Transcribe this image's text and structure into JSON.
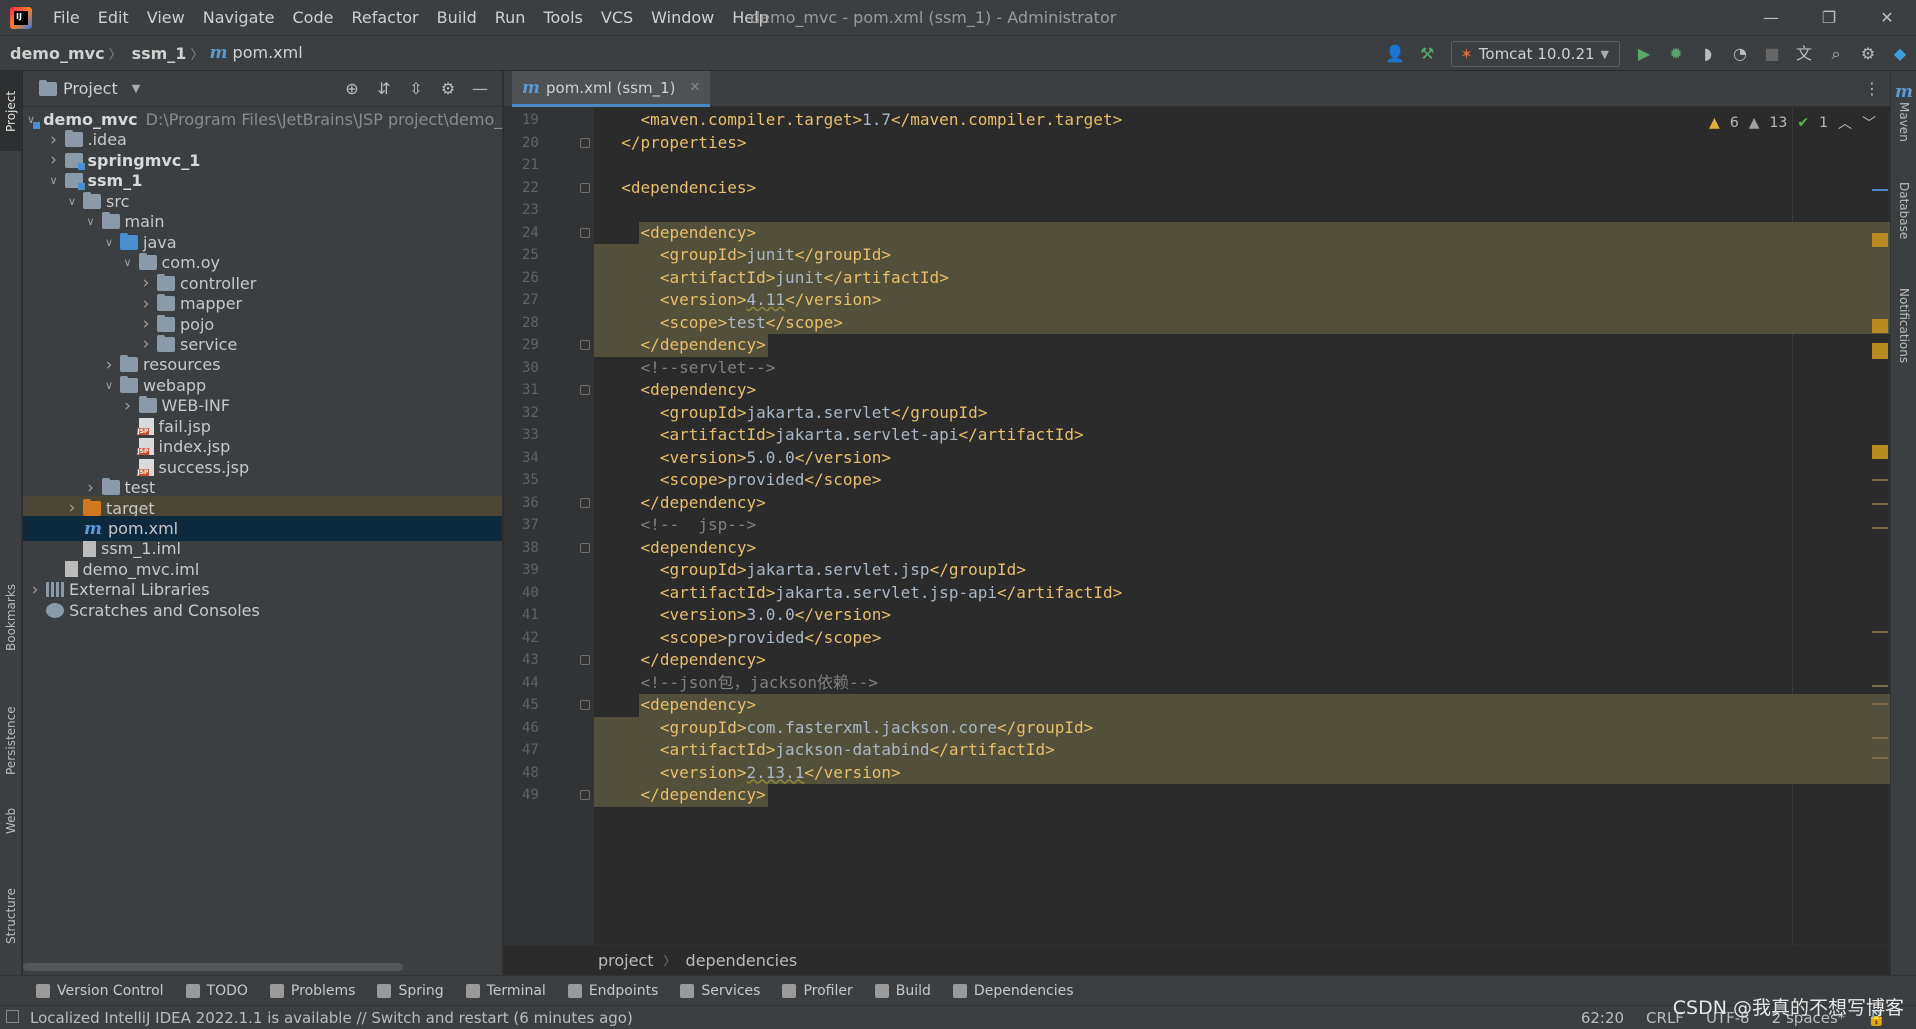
{
  "menubar": {
    "items": [
      "File",
      "Edit",
      "View",
      "Navigate",
      "Code",
      "Refactor",
      "Build",
      "Run",
      "Tools",
      "VCS",
      "Window",
      "Help"
    ],
    "window_title": "demo_mvc - pom.xml (ssm_1) - Administrator"
  },
  "navbar": {
    "crumbs": [
      "demo_mvc",
      "ssm_1"
    ],
    "file": "pom.xml",
    "run_config": "Tomcat 10.0.21"
  },
  "left_strip": {
    "tabs": [
      "Project",
      "Bookmarks",
      "Persistence",
      "Web",
      "Structure"
    ]
  },
  "project_panel": {
    "title": "Project",
    "tree": [
      {
        "label": "demo_mvc",
        "path": "D:\\Program Files\\JetBrains\\JSP project\\demo_",
        "depth": 0,
        "arrow": "down",
        "icon": "module",
        "bold": true
      },
      {
        "label": ".idea",
        "depth": 1,
        "arrow": "right",
        "icon": "folder"
      },
      {
        "label": "springmvc_1",
        "depth": 1,
        "arrow": "right",
        "icon": "module",
        "bold": true
      },
      {
        "label": "ssm_1",
        "depth": 1,
        "arrow": "down",
        "icon": "module",
        "bold": true
      },
      {
        "label": "src",
        "depth": 2,
        "arrow": "down",
        "icon": "folder"
      },
      {
        "label": "main",
        "depth": 3,
        "arrow": "down",
        "icon": "folder"
      },
      {
        "label": "java",
        "depth": 4,
        "arrow": "down",
        "icon": "folder-blue"
      },
      {
        "label": "com.oy",
        "depth": 5,
        "arrow": "down",
        "icon": "folder"
      },
      {
        "label": "controller",
        "depth": 6,
        "arrow": "right",
        "icon": "folder"
      },
      {
        "label": "mapper",
        "depth": 6,
        "arrow": "right",
        "icon": "folder"
      },
      {
        "label": "pojo",
        "depth": 6,
        "arrow": "right",
        "icon": "folder"
      },
      {
        "label": "service",
        "depth": 6,
        "arrow": "right",
        "icon": "folder"
      },
      {
        "label": "resources",
        "depth": 4,
        "arrow": "right",
        "icon": "folder-res"
      },
      {
        "label": "webapp",
        "depth": 4,
        "arrow": "down",
        "icon": "folder"
      },
      {
        "label": "WEB-INF",
        "depth": 5,
        "arrow": "right",
        "icon": "folder"
      },
      {
        "label": "fail.jsp",
        "depth": 5,
        "arrow": "",
        "icon": "jsp"
      },
      {
        "label": "index.jsp",
        "depth": 5,
        "arrow": "",
        "icon": "jsp"
      },
      {
        "label": "success.jsp",
        "depth": 5,
        "arrow": "",
        "icon": "jsp"
      },
      {
        "label": "test",
        "depth": 3,
        "arrow": "right",
        "icon": "folder"
      },
      {
        "label": "target",
        "depth": 2,
        "arrow": "right",
        "icon": "folder-orange",
        "state": "excluded"
      },
      {
        "label": "pom.xml",
        "depth": 2,
        "arrow": "",
        "icon": "maven",
        "state": "selected"
      },
      {
        "label": "ssm_1.iml",
        "depth": 2,
        "arrow": "",
        "icon": "iml"
      },
      {
        "label": "demo_mvc.iml",
        "depth": 1,
        "arrow": "",
        "icon": "iml"
      },
      {
        "label": "External Libraries",
        "depth": 0,
        "arrow": "right",
        "icon": "lib"
      },
      {
        "label": "Scratches and Consoles",
        "depth": 0,
        "arrow": "",
        "icon": "scratch"
      }
    ]
  },
  "editor": {
    "tab_label": "pom.xml (ssm_1)",
    "inspections": {
      "warnings": "6",
      "weak_warnings": "13",
      "ok": "1"
    },
    "lines": [
      {
        "n": "19",
        "indent": 2,
        "parts": [
          [
            "tag",
            "<maven.compiler.target>"
          ],
          [
            "txt",
            "1.7"
          ],
          [
            "tag",
            "</maven.compiler.target>"
          ]
        ]
      },
      {
        "n": "20",
        "indent": 1,
        "parts": [
          [
            "tag",
            "</properties>"
          ]
        ],
        "fold": true
      },
      {
        "n": "21",
        "indent": 0,
        "parts": []
      },
      {
        "n": "22",
        "indent": 1,
        "parts": [
          [
            "tag",
            "<dependencies>"
          ]
        ],
        "fold": true
      },
      {
        "n": "23",
        "indent": 0,
        "parts": []
      },
      {
        "n": "24",
        "indent": 2,
        "parts": [
          [
            "tag",
            "<dependency>"
          ]
        ],
        "fold": true,
        "hl": "tagonly"
      },
      {
        "n": "25",
        "indent": 3,
        "parts": [
          [
            "tag",
            "<groupId>"
          ],
          [
            "txt",
            "junit"
          ],
          [
            "tag",
            "</groupId>"
          ]
        ],
        "hl": "full"
      },
      {
        "n": "26",
        "indent": 3,
        "parts": [
          [
            "tag",
            "<artifactId>"
          ],
          [
            "txt",
            "junit"
          ],
          [
            "tag",
            "</artifactId>"
          ]
        ],
        "hl": "full"
      },
      {
        "n": "27",
        "indent": 3,
        "parts": [
          [
            "tag",
            "<version>"
          ],
          [
            "txtwarn",
            "4.11"
          ],
          [
            "tag",
            "</version>"
          ]
        ],
        "hl": "full"
      },
      {
        "n": "28",
        "indent": 3,
        "parts": [
          [
            "tag",
            "<scope>"
          ],
          [
            "txt",
            "test"
          ],
          [
            "tag",
            "</scope>"
          ]
        ],
        "hl": "full"
      },
      {
        "n": "29",
        "indent": 2,
        "parts": [
          [
            "tag",
            "</dependency>"
          ]
        ],
        "fold": true,
        "hl": "endtag"
      },
      {
        "n": "30",
        "indent": 2,
        "parts": [
          [
            "cmt",
            "<!--servlet-->"
          ]
        ]
      },
      {
        "n": "31",
        "indent": 2,
        "parts": [
          [
            "tag",
            "<dependency>"
          ]
        ],
        "fold": true
      },
      {
        "n": "32",
        "indent": 3,
        "parts": [
          [
            "tag",
            "<groupId>"
          ],
          [
            "txt",
            "jakarta.servlet"
          ],
          [
            "tag",
            "</groupId>"
          ]
        ]
      },
      {
        "n": "33",
        "indent": 3,
        "parts": [
          [
            "tag",
            "<artifactId>"
          ],
          [
            "txt",
            "jakarta.servlet-api"
          ],
          [
            "tag",
            "</artifactId>"
          ]
        ]
      },
      {
        "n": "34",
        "indent": 3,
        "parts": [
          [
            "tag",
            "<version>"
          ],
          [
            "txt",
            "5.0.0"
          ],
          [
            "tag",
            "</version>"
          ]
        ]
      },
      {
        "n": "35",
        "indent": 3,
        "parts": [
          [
            "tag",
            "<scope>"
          ],
          [
            "txt",
            "provided"
          ],
          [
            "tag",
            "</scope>"
          ]
        ]
      },
      {
        "n": "36",
        "indent": 2,
        "parts": [
          [
            "tag",
            "</dependency>"
          ]
        ],
        "fold": true
      },
      {
        "n": "37",
        "indent": 2,
        "parts": [
          [
            "cmt",
            "<!--  jsp-->"
          ]
        ]
      },
      {
        "n": "38",
        "indent": 2,
        "parts": [
          [
            "tag",
            "<dependency>"
          ]
        ],
        "fold": true
      },
      {
        "n": "39",
        "indent": 3,
        "parts": [
          [
            "tag",
            "<groupId>"
          ],
          [
            "txt",
            "jakarta.servlet.jsp"
          ],
          [
            "tag",
            "</groupId>"
          ]
        ]
      },
      {
        "n": "40",
        "indent": 3,
        "parts": [
          [
            "tag",
            "<artifactId>"
          ],
          [
            "txt",
            "jakarta.servlet.jsp-api"
          ],
          [
            "tag",
            "</artifactId>"
          ]
        ]
      },
      {
        "n": "41",
        "indent": 3,
        "parts": [
          [
            "tag",
            "<version>"
          ],
          [
            "txt",
            "3.0.0"
          ],
          [
            "tag",
            "</version>"
          ]
        ]
      },
      {
        "n": "42",
        "indent": 3,
        "parts": [
          [
            "tag",
            "<scope>"
          ],
          [
            "txt",
            "provided"
          ],
          [
            "tag",
            "</scope>"
          ]
        ]
      },
      {
        "n": "43",
        "indent": 2,
        "parts": [
          [
            "tag",
            "</dependency>"
          ]
        ],
        "fold": true
      },
      {
        "n": "44",
        "indent": 2,
        "parts": [
          [
            "cmt",
            "<!--json包，jackson依赖-->"
          ]
        ]
      },
      {
        "n": "45",
        "indent": 2,
        "parts": [
          [
            "tag",
            "<dependency>"
          ]
        ],
        "fold": true,
        "hl": "tagonly"
      },
      {
        "n": "46",
        "indent": 3,
        "parts": [
          [
            "tag",
            "<groupId>"
          ],
          [
            "txt",
            "com.fasterxml.jackson.core"
          ],
          [
            "tag",
            "</groupId>"
          ]
        ],
        "hl": "full"
      },
      {
        "n": "47",
        "indent": 3,
        "parts": [
          [
            "tag",
            "<artifactId>"
          ],
          [
            "txt",
            "jackson-databind"
          ],
          [
            "tag",
            "</artifactId>"
          ]
        ],
        "hl": "full"
      },
      {
        "n": "48",
        "indent": 3,
        "parts": [
          [
            "tag",
            "<version>"
          ],
          [
            "txtwarn",
            "2.13.1"
          ],
          [
            "tag",
            "</version>"
          ]
        ],
        "hl": "full"
      },
      {
        "n": "49",
        "indent": 2,
        "parts": [
          [
            "tag",
            "</dependency>"
          ]
        ],
        "fold": true,
        "hl": "endtag"
      }
    ],
    "breadcrumb": [
      "project",
      "dependencies"
    ]
  },
  "right_strip": {
    "tabs": [
      "Maven",
      "Database",
      "Notifications"
    ]
  },
  "tool_bar": {
    "items": [
      "Version Control",
      "TODO",
      "Problems",
      "Spring",
      "Terminal",
      "Endpoints",
      "Services",
      "Profiler",
      "Build",
      "Dependencies"
    ]
  },
  "status_bar": {
    "message": "Localized IntelliJ IDEA 2022.1.1 is available // Switch and restart (6 minutes ago)",
    "position": "62:20",
    "line_sep": "CRLF",
    "encoding": "UTF-8",
    "indent": "2 spaces*"
  },
  "watermark": "CSDN @我真的不想写博客"
}
